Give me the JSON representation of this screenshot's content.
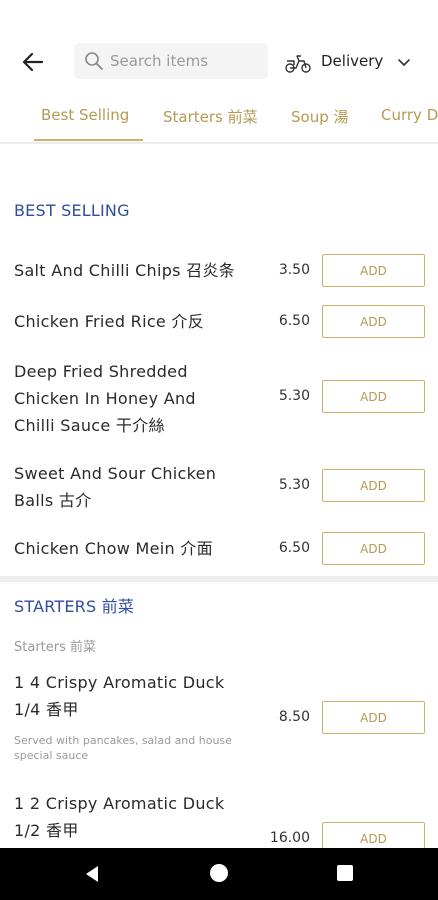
{
  "search": {
    "placeholder": "Search items"
  },
  "delivery": {
    "label": "Delivery"
  },
  "tabs": [
    {
      "label": "Best Selling"
    },
    {
      "label": "Starters 前菜"
    },
    {
      "label": "Soup 湯"
    },
    {
      "label": "Curry D"
    }
  ],
  "best_selling": {
    "title": "BEST SELLING",
    "items": [
      {
        "name": "Salt And Chilli Chips 召炎条",
        "price": "3.50",
        "action": "ADD"
      },
      {
        "name": "Chicken Fried Rice 介反",
        "price": "6.50",
        "action": "ADD"
      },
      {
        "name": "Deep Fried Shredded Chicken In Honey And Chilli Sauce 干介絲",
        "price": "5.30",
        "action": "ADD"
      },
      {
        "name": "Sweet And Sour Chicken Balls 古介",
        "price": "5.30",
        "action": "ADD"
      },
      {
        "name": "Chicken Chow Mein 介面",
        "price": "6.50",
        "action": "ADD"
      }
    ]
  },
  "starters": {
    "title": "STARTERS 前菜",
    "subtitle": "Starters 前菜",
    "items": [
      {
        "name": "1 4 Crispy Aromatic Duck 1/4 香甲",
        "desc": "Served with pancakes, salad and house special sauce",
        "price": "8.50",
        "action": "ADD"
      },
      {
        "name": "1 2 Crispy Aromatic Duck 1/2 香甲",
        "price": "16.00",
        "action": "ADD"
      }
    ]
  },
  "colors": {
    "accent": "#c9b26a",
    "section_title": "#2f4ea0"
  }
}
